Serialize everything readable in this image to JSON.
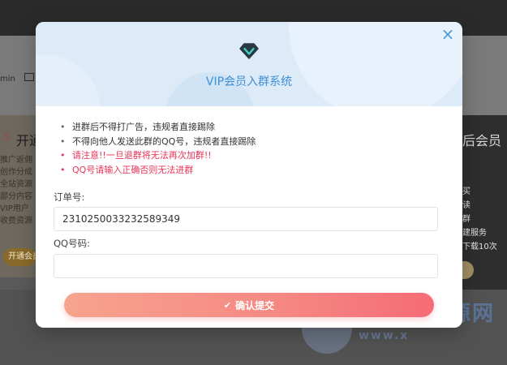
{
  "background": {
    "admin_text": "min",
    "left_card": {
      "title": "开通",
      "lines": [
        "推广返佣",
        "创作分成",
        "全站资源",
        "部分内容",
        "VIP用户",
        "收费资源"
      ],
      "button": "开通会员"
    },
    "right_card": {
      "title": "后会员",
      "lines": [
        "买",
        "读",
        "群",
        "建服务",
        "下载10次"
      ]
    },
    "watermark": {
      "text": "小蚂蚁资源网",
      "url": "www.x"
    }
  },
  "modal": {
    "title": "VIP会员入群系统",
    "close_icon": "×",
    "diamond_icon": "diamond-icon",
    "rules": [
      {
        "text": "进群后不得打广告，违规者直接踢除",
        "warn": false
      },
      {
        "text": "不得向他人发送此群的QQ号，违规者直接踢除",
        "warn": false
      },
      {
        "text": "请注意!!一旦退群将无法再次加群!!",
        "warn": true
      },
      {
        "text": "QQ号请输入正确否则无法进群",
        "warn": true
      }
    ],
    "order_label": "订单号:",
    "order_value": "2310250033232589349",
    "qq_label": "QQ号码:",
    "qq_value": "",
    "qq_placeholder": "",
    "submit_label": "确认提交",
    "submit_icon": "check-icon"
  },
  "colors": {
    "accent": "#3d8fd6",
    "warning": "#e8345a",
    "button_start": "#f7a38d",
    "button_end": "#f56c76"
  }
}
